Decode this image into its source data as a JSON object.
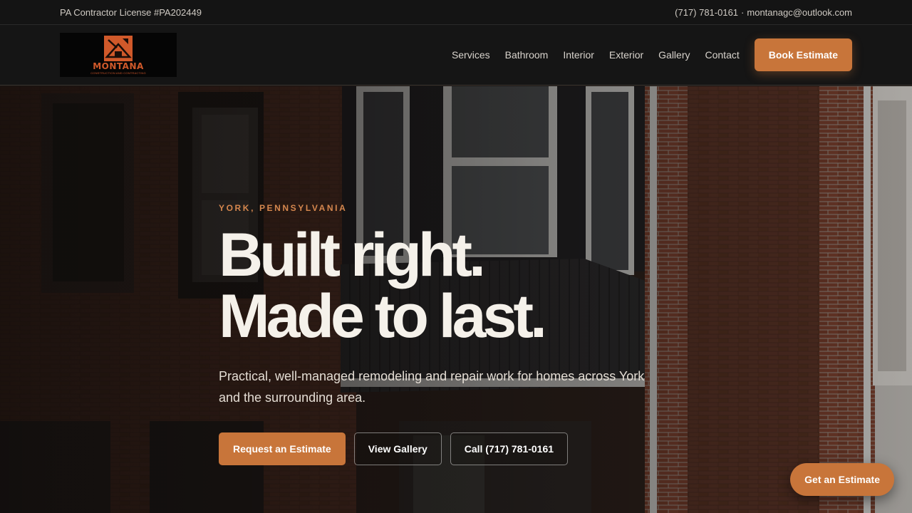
{
  "topbar": {
    "license": "PA Contractor License #PA202449",
    "phone": "(717) 781-0161",
    "separator": "·",
    "email": "montanagc@outlook.com"
  },
  "logo": {
    "name": "MONTANA",
    "tagline": "CONSTRUCTION AND CONTRACTING"
  },
  "nav": {
    "items": [
      "Services",
      "Bathroom",
      "Interior",
      "Exterior",
      "Gallery",
      "Contact"
    ],
    "book_label": "Book Estimate"
  },
  "hero": {
    "eyebrow": "YORK, PENNSYLVANIA",
    "headline_line1": "Built right.",
    "headline_line2": "Made to last.",
    "subtext": "Practical, well-managed remodeling and repair work for homes across York and the surrounding area.",
    "cta_primary": "Request an Estimate",
    "cta_gallery": "View Gallery",
    "cta_call": "Call (717) 781-0161"
  },
  "floating": {
    "label": "Get an Estimate"
  },
  "colors": {
    "accent": "#c8753a",
    "eyebrow": "#d5874e",
    "logo_red": "#d0592a",
    "topbar_bg": "#141414",
    "nav_bg": "#151515"
  }
}
